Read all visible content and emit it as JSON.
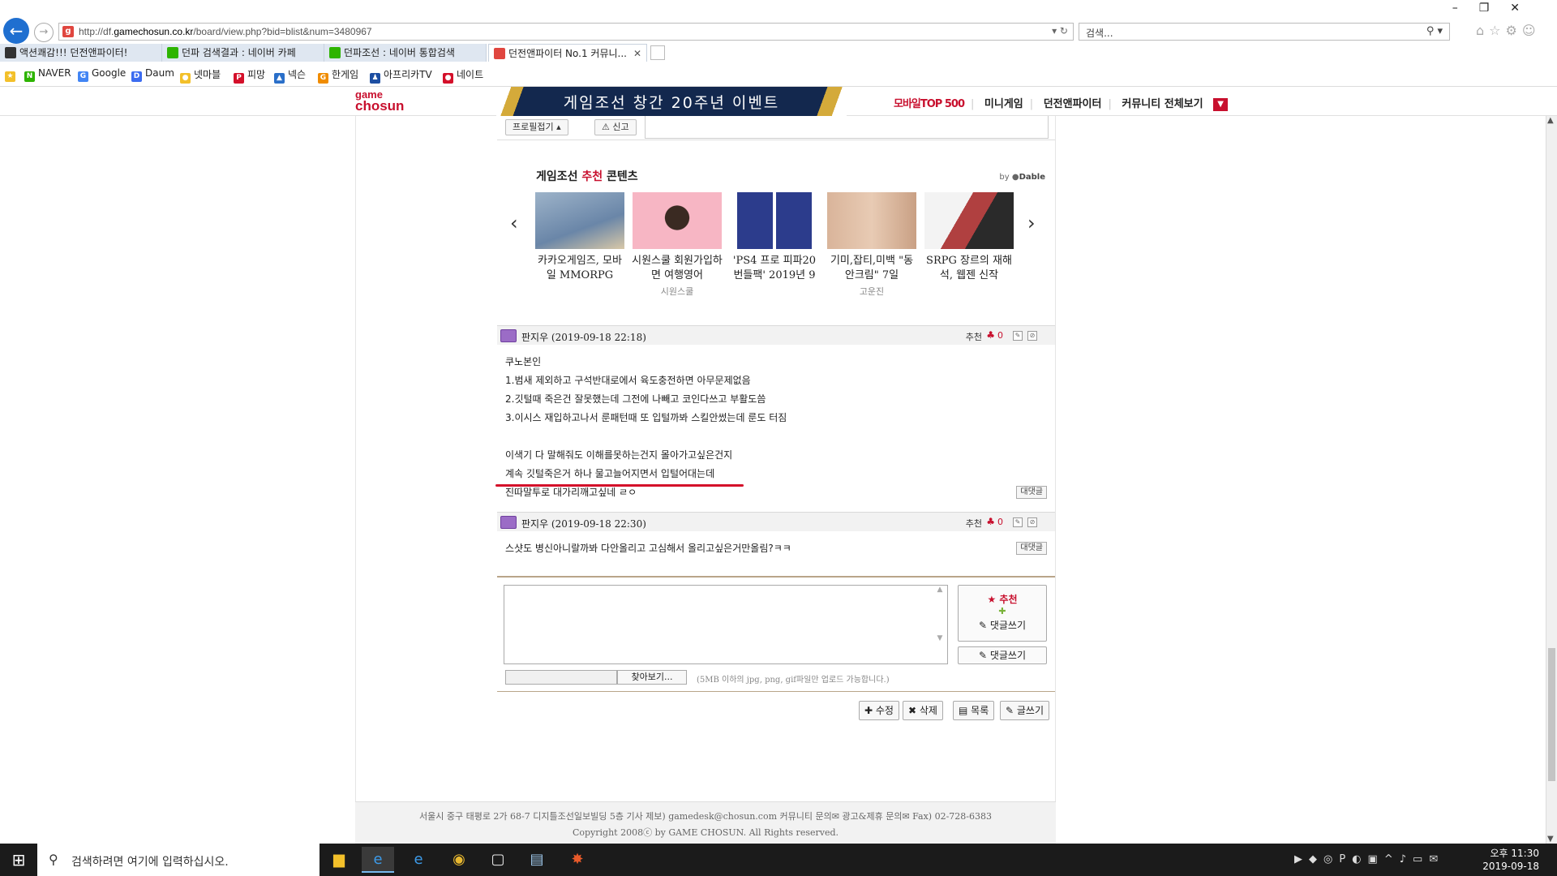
{
  "browser": {
    "url_prefix": "http://df.",
    "url_domain": "gamechosun.co.kr",
    "url_path": "/board/view.php?bid=blist&num=3480967",
    "search_placeholder": "검색...",
    "tabs": [
      {
        "label": "액션쾌감!!! 던전앤파이터!",
        "color": "#333333"
      },
      {
        "label": "던파 검색결과 : 네이버 카페",
        "color": "#2db400"
      },
      {
        "label": "던파조선 : 네이버 통합검색",
        "color": "#2db400"
      },
      {
        "label": "던전앤파이터 No.1 커뮤니...",
        "color": "#e0463f"
      }
    ],
    "favorites": [
      {
        "label": "NAVER",
        "color": "#2db400",
        "glyph": "N"
      },
      {
        "label": "Google",
        "color": "#4285f4",
        "glyph": "G"
      },
      {
        "label": "Daum",
        "color": "#3c6cf0",
        "glyph": "D"
      },
      {
        "label": "넷마블",
        "color": "#f3c02a",
        "glyph": "●"
      },
      {
        "label": "피망",
        "color": "#d4102a",
        "glyph": "P"
      },
      {
        "label": "넥슨",
        "color": "#2a6fc9",
        "glyph": "▲"
      },
      {
        "label": "한게임",
        "color": "#f08c00",
        "glyph": "G"
      },
      {
        "label": "아프리카TV",
        "color": "#1d4fa2",
        "glyph": "♟"
      },
      {
        "label": "네이트",
        "color": "#d4102a",
        "glyph": "●"
      }
    ]
  },
  "site": {
    "logo_top": "game",
    "logo_bottom": "chosun",
    "banner_text": "게임조선 창간 20주년 이벤트",
    "nav": [
      "모바일TOP 500",
      "미니게임",
      "던전앤파이터",
      "커뮤니티 전체보기"
    ]
  },
  "article_tools": {
    "profile_fold": "프로필접기 ▴",
    "report": "신고"
  },
  "recommend": {
    "title_pre": "게임조선 ",
    "title_red": "추천",
    "title_post": " 콘텐츠",
    "by": "by ",
    "by_brand": "Dable",
    "items": [
      {
        "caption": "카카오게임즈, 모바일 MMORPG",
        "source": "",
        "color": "#6a86a8"
      },
      {
        "caption": "시원스쿨 회원가입하면 여행영어",
        "source": "시원스쿨",
        "color": "#f7b6c4"
      },
      {
        "caption": "'PS4 프로 피파20 번들팩' 2019년 9",
        "source": "",
        "color": "#2c3c8c"
      },
      {
        "caption": "기미,잡티,미백 \"동안크림\" 7일",
        "source": "고운진",
        "color": "#d9b49a"
      },
      {
        "caption": "SRPG 장르의 재해석, 웹젠 신작",
        "source": "",
        "color": "#b04040"
      }
    ]
  },
  "comments": [
    {
      "author": "판지우 (2019-09-18 22:18)",
      "rec_label": "추천",
      "rec_count": "0",
      "lines": [
        "쿠노본인",
        "1.범새 제외하고 구석반대로에서 육도충전하면 아무문제없음",
        "2.깃털때 죽은건 잘못했는데 그전에 나빼고 코인다쓰고 부활도씀",
        "3.이시스 재입하고나서 룬패턴때 또 입털까봐 스킬안썼는데 룬도 터짐",
        "",
        "이색기 다 말해줘도 이해를못하는건지 몰아가고싶은건지",
        "계속 깃털죽은거 하나 물고늘어지면서 입털어대는데",
        "진따말투로 대가리깨고싶네 ㄹㅇ"
      ],
      "reply": "대댓글"
    },
    {
      "author": "판지우 (2019-09-18 22:30)",
      "rec_label": "추천",
      "rec_count": "0",
      "lines": [
        "스샷도 병신아니랄까봐 다안올리고 고심해서 올리고싶은거만올림?ㅋㅋ"
      ],
      "reply": "대댓글"
    }
  ],
  "comment_form": {
    "recommend": "★ 추천",
    "plus": "✚",
    "write_with_rec": "✎ 댓글쓰기",
    "write": "✎ 댓글쓰기",
    "browse": "찾아보기...",
    "note": "(5MB 이하의 jpg, png, gif파일만 업로드 가능합니다.)"
  },
  "actions": {
    "edit": "✚ 수정",
    "delete": "✖ 삭제",
    "list": "▤ 목록",
    "write": "✎ 글쓰기"
  },
  "footer": {
    "line1": "서울시 중구 태평로 2가 68-7 디지틀조선일보빌딩 5층 기사 제보) gamedesk@chosun.com   커뮤니티 문의✉  광고&제휴 문의✉  Fax) 02-728-6383",
    "line2": "Copyright 2008ⓒ by GAME CHOSUN. All Rights reserved."
  },
  "taskbar": {
    "search_placeholder": "검색하려면 여기에 입력하십시오.",
    "time": "오후 11:30",
    "date": "2019-09-18"
  }
}
